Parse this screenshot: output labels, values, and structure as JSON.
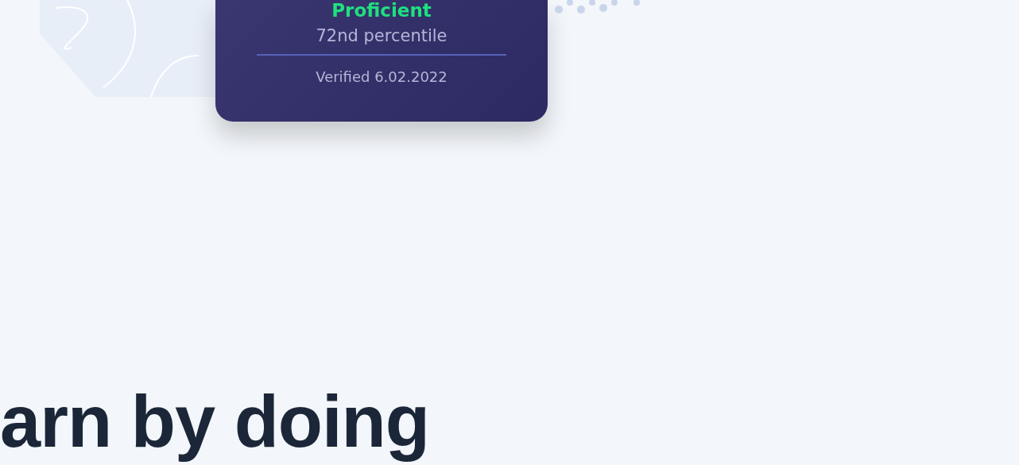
{
  "card": {
    "level_label": "Proficient",
    "percentile": "72nd percentile",
    "verified": "Verified 6.02.2022"
  },
  "headline": "arn by doing"
}
